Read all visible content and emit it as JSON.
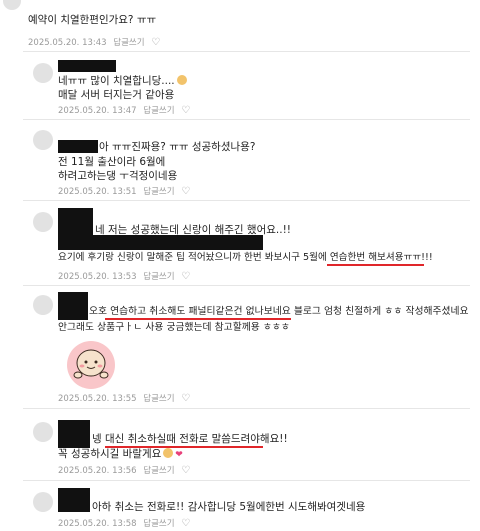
{
  "comments": [
    {
      "text": "예약이 치열한편인가요? ㅠㅠ",
      "date": "2025.05.20. 13:43",
      "reply": "답글쓰기"
    },
    {
      "lines": [
        "네ㅠㅠ 많이 치열합니당....",
        "매달 서버 터지는거 같아용"
      ],
      "date": "2025.05.20. 13:47",
      "reply": "답글쓰기"
    },
    {
      "lines": [
        "아 ㅠㅠ진짜용? ㅠㅠ 성공하셨나용?",
        "전 11월 출산이라 6월에",
        "하려고하는댕 ㅜ걱정이네용"
      ],
      "date": "2025.05.20. 13:51",
      "reply": "답글쓰기"
    },
    {
      "lines": [
        "네 저는 성공했는데 신랑이 해주긴 했어요..!!",
        "요기에 후기랑 신랑이 말해준 팁 적어놨으니까 한번 봐보시구 5월에 연습한번 해보셔용ㅠㅠ!!!"
      ],
      "date": "2025.05.20. 13:53",
      "reply": "답글쓰기"
    },
    {
      "lines": [
        "오호 연습하고 취소해도 패널티같은건 없나보네요 블로그 엄청 친절하게 ㅎㅎ 작성해주셨네요",
        "안그래도 상품구ㅏㄴ 사용 궁금했는데 참고할께용 ㅎㅎㅎ"
      ],
      "date": "2025.05.20. 13:55",
      "reply": "답글쓰기"
    },
    {
      "lines": [
        "넹 대신 취소하실때 전화로 말씀드려야해요!!",
        "꼭 성공하시길 바랄게요"
      ],
      "date": "2025.05.20. 13:56",
      "reply": "답글쓰기"
    },
    {
      "lines": [
        "아하 취소는 전화로!! 감사합니당 5월에한번 시도해봐여겟네용"
      ],
      "date": "2025.05.20. 13:58",
      "reply": "답글쓰기"
    }
  ],
  "colors": {
    "underline": "#e0262a",
    "meta": "#9a9a9a",
    "redaction": "#111111"
  },
  "icons": [
    "heart-icon",
    "avatar",
    "smile-emoji",
    "hearts-emoji",
    "sticker-character"
  ]
}
